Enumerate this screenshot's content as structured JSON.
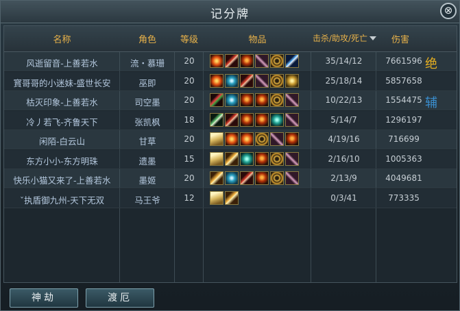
{
  "window": {
    "title": "记分牌",
    "close_label": "⊗"
  },
  "header": {
    "name": "名称",
    "role": "角色",
    "level": "等级",
    "items": "物品",
    "kda": "击杀/助攻/死亡",
    "damage": "伤害"
  },
  "rows": [
    {
      "name": "风逝留音-上善若水",
      "role": "流・慕珊",
      "level": "20",
      "kda": "35/14/12",
      "damage": "7661596",
      "badge": "绝",
      "badge_color": "#e8b020",
      "items": [
        "fire-orb",
        "blade",
        "ember",
        "scroll-x",
        "gold-swirl",
        "blue-sword"
      ]
    },
    {
      "name": "寳哥哥的小迷妹-盛世长安",
      "role": "巫即",
      "level": "20",
      "kda": "25/18/14",
      "damage": "5857658",
      "badge": "",
      "badge_color": "",
      "items": [
        "fire-orb",
        "teal-swirl",
        "blade",
        "scroll-x",
        "gold-swirl",
        "gold-orb"
      ]
    },
    {
      "name": "枯灭印象-上善若水",
      "role": "司空墨",
      "level": "20",
      "kda": "10/22/13",
      "damage": "1554475",
      "badge": "辅",
      "badge_color": "#3a8fd0",
      "items": [
        "red-blade",
        "teal-swirl",
        "ember",
        "ember",
        "gold-swirl",
        "scroll-x"
      ]
    },
    {
      "name": "冷丿若飞-齐鲁天下",
      "role": "张凯枫",
      "level": "18",
      "kda": "5/14/7",
      "damage": "1296197",
      "badge": "",
      "badge_color": "",
      "items": [
        "green-blade",
        "blade",
        "ember",
        "ember",
        "teal-orb",
        "scroll-x"
      ]
    },
    {
      "name": "闲陌-白云山",
      "role": "甘草",
      "level": "20",
      "kda": "4/19/16",
      "damage": "716699",
      "badge": "",
      "badge_color": "",
      "items": [
        "parchment",
        "fire-orb",
        "fire-orb",
        "gold-swirl",
        "scroll-x",
        "ember"
      ]
    },
    {
      "name": "东方小小-东方明珠",
      "role": "遗墨",
      "level": "15",
      "kda": "2/16/10",
      "damage": "1005363",
      "badge": "",
      "badge_color": "",
      "items": [
        "parchment",
        "gold-scroll",
        "teal-orb",
        "ember",
        "gold-swirl",
        "scroll-x"
      ]
    },
    {
      "name": "快乐小猫又来了-上善若水",
      "role": "墨姬",
      "level": "20",
      "kda": "2/13/9",
      "damage": "4049681",
      "badge": "",
      "badge_color": "",
      "items": [
        "gold-scroll",
        "teal-swirl",
        "blade",
        "ember",
        "gold-swirl",
        "scroll-x"
      ]
    },
    {
      "name": "ˇ执盾御九州-天下无双",
      "role": "马王爷",
      "level": "12",
      "kda": "0/3/41",
      "damage": "773335",
      "badge": "",
      "badge_color": "",
      "items": [
        "parchment",
        "gold-scroll"
      ]
    }
  ],
  "footer": {
    "left_button": "神劫",
    "right_button": "渡厄"
  },
  "colors": {
    "header_text": "#e8b24a",
    "name_text": "#b4c8de"
  }
}
